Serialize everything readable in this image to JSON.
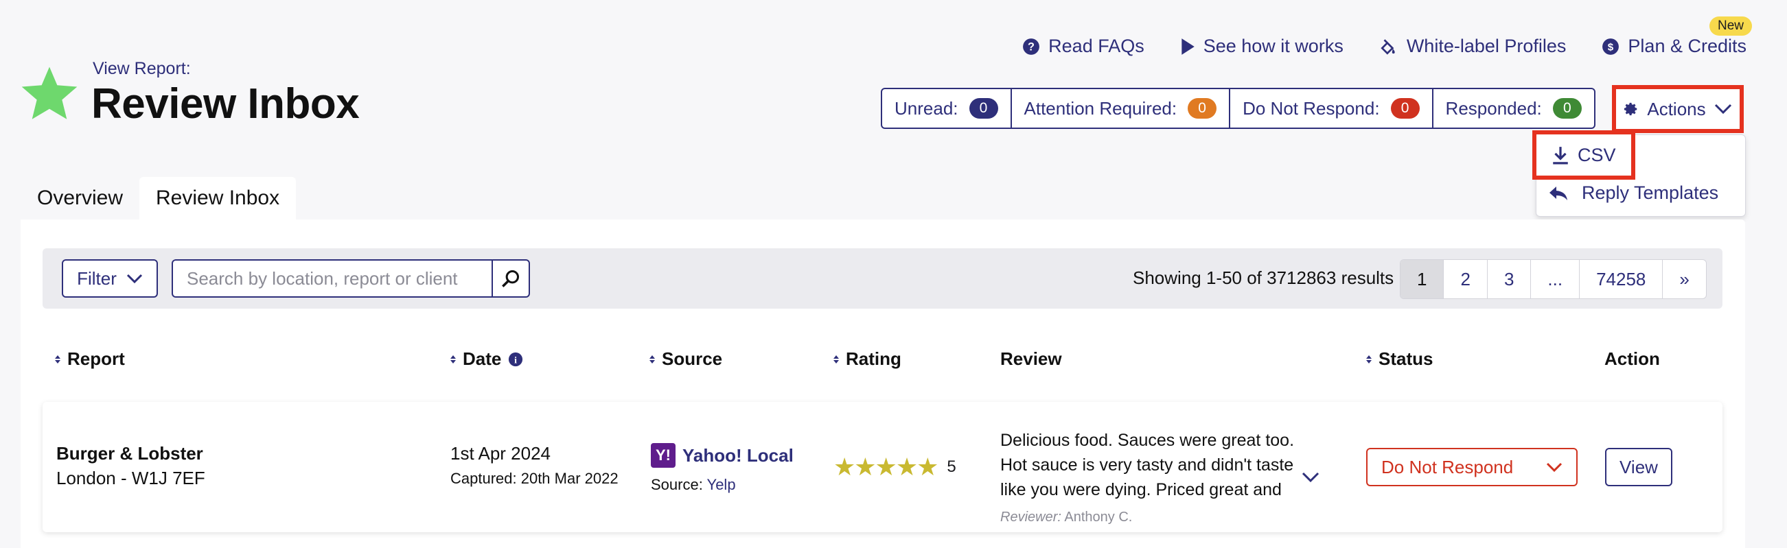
{
  "header": {
    "view_report_label": "View Report:",
    "title": "Review Inbox",
    "star_color": "#6ed86d"
  },
  "top_links": [
    {
      "icon": "question-circle-icon",
      "label": "Read FAQs"
    },
    {
      "icon": "play-icon",
      "label": "See how it works"
    },
    {
      "icon": "paint-brush-icon",
      "label": "White-label Profiles"
    },
    {
      "icon": "dollar-circle-icon",
      "label": "Plan & Credits",
      "badge": "New"
    }
  ],
  "status_counts": [
    {
      "label": "Unread:",
      "count": "0",
      "color": "#2e2f7a"
    },
    {
      "label": "Attention Required:",
      "count": "0",
      "color": "#e07a22"
    },
    {
      "label": "Do Not Respond:",
      "count": "0",
      "color": "#d0321f"
    },
    {
      "label": "Responded:",
      "count": "0",
      "color": "#3f8a35"
    }
  ],
  "actions": {
    "button_label": "Actions",
    "menu": [
      {
        "icon": "download-icon",
        "label": "CSV"
      },
      {
        "icon": "reply-icon",
        "label": "Reply Templates"
      }
    ]
  },
  "tabs": [
    {
      "label": "Overview",
      "active": false
    },
    {
      "label": "Review Inbox",
      "active": true
    }
  ],
  "toolbar": {
    "filter_label": "Filter",
    "search_placeholder": "Search by location, report or client",
    "showing_text": "Showing 1-50 of 3712863 results",
    "pages": [
      "1",
      "2",
      "3",
      "...",
      "74258",
      "»"
    ],
    "active_page": "1"
  },
  "columns": [
    "Report",
    "Date",
    "Source",
    "Rating",
    "Review",
    "Status",
    "Action"
  ],
  "rows": [
    {
      "report_name": "Burger & Lobster",
      "report_location": "London - W1J 7EF",
      "date": "1st Apr 2024",
      "captured": "Captured: 20th Mar 2022",
      "source_name": "Yahoo! Local",
      "source_label": "Source:",
      "source_sub": "Yelp",
      "rating": "5",
      "review_text": "Delicious food. Sauces were great too. Hot sauce is very tasty and didn't taste like you were dying. Priced great and",
      "reviewer_label": "Reviewer:",
      "reviewer_name": "Anthony C.",
      "status": "Do Not Respond",
      "action_label": "View"
    }
  ],
  "colors": {
    "brand_navy": "#2e2f7a",
    "highlight_red": "#e5321f",
    "star_gold": "#c9b931"
  }
}
